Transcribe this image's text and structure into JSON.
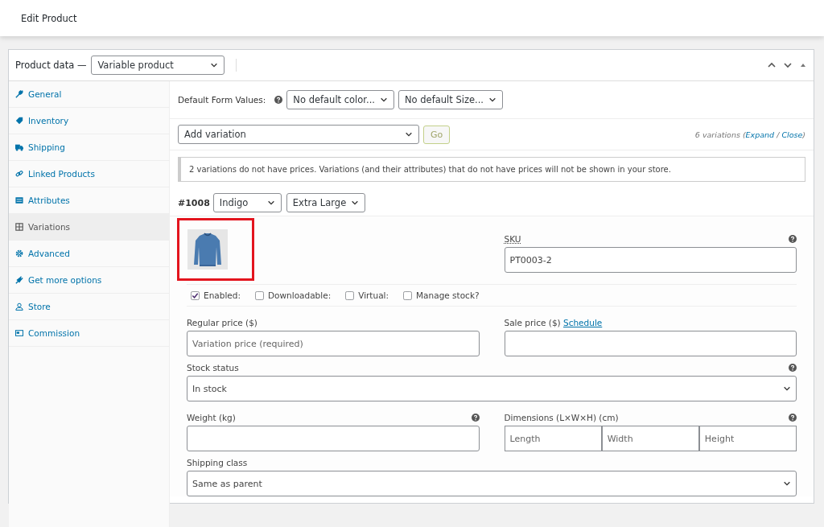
{
  "page": {
    "title": "Edit Product"
  },
  "product_data": {
    "label": "Product data —",
    "type": "Variable product"
  },
  "sidebar": {
    "items": [
      {
        "label": "General",
        "selected": false
      },
      {
        "label": "Inventory",
        "selected": false
      },
      {
        "label": "Shipping",
        "selected": false
      },
      {
        "label": "Linked Products",
        "selected": false
      },
      {
        "label": "Attributes",
        "selected": false
      },
      {
        "label": "Variations",
        "selected": true
      },
      {
        "label": "Advanced",
        "selected": false
      },
      {
        "label": "Get more options",
        "selected": false
      },
      {
        "label": "Store",
        "selected": false
      },
      {
        "label": "Commission",
        "selected": false
      }
    ]
  },
  "default_form_values": {
    "label": "Default Form Values:",
    "selects": [
      "No default color...",
      "No default Size..."
    ]
  },
  "add_variation": {
    "select": "Add variation",
    "button": "Go",
    "count": "6 variations (",
    "links": [
      "Expand",
      "Close"
    ],
    "separator": " / ",
    "suffix": ")"
  },
  "notice": "2 variations do not have prices. Variations (and their attributes) that do not have prices will not be shown in your store.",
  "variation": {
    "id": "#1008",
    "selects": [
      "Indigo",
      "Extra Large"
    ],
    "image": {
      "kind": "picture"
    },
    "sku": {
      "label": "SKU",
      "value": "PT0003-2"
    },
    "options": [
      {
        "label": "Enabled:",
        "checked": true
      },
      {
        "label": "Downloadable:",
        "checked": false
      },
      {
        "label": "Virtual:",
        "checked": false
      },
      {
        "label": "Manage stock?",
        "checked": false
      }
    ],
    "regular_price": {
      "label": "Regular price ($)",
      "placeholder": "Variation price (required)"
    },
    "sale_price": {
      "label": "Sale price ($)",
      "link": "Schedule"
    },
    "stock_status": {
      "label": "Stock status",
      "value": "In stock"
    },
    "weight": {
      "label": "Weight (kg)"
    },
    "dimensions": {
      "label": "Dimensions (L×W×H) (cm)",
      "placeholders": [
        "Length",
        "Width",
        "Height"
      ]
    },
    "shipping_class": {
      "label": "Shipping class",
      "value": "Same as parent"
    }
  }
}
